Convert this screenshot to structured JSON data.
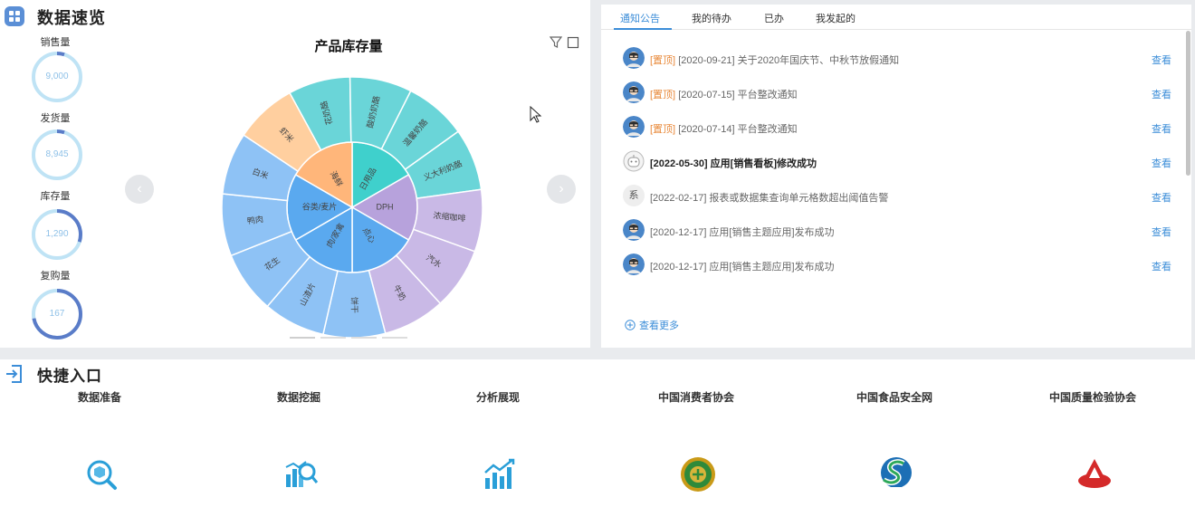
{
  "overview": {
    "title": "数据速览",
    "metrics": [
      {
        "label": "销售量",
        "value": "9,000",
        "fill": 0.05
      },
      {
        "label": "发货量",
        "value": "8,945",
        "fill": 0.05
      },
      {
        "label": "库存量",
        "value": "1,290",
        "fill": 0.3
      },
      {
        "label": "复购量",
        "value": "167",
        "fill": 0.72
      }
    ]
  },
  "chart_data": {
    "type": "sunburst",
    "title": "产品库存量",
    "inner": [
      {
        "name": "日用品",
        "color": "#3fd0cc"
      },
      {
        "name": "DPH",
        "color": "#b7a2dc"
      },
      {
        "name": "点心",
        "color": "#5aa9ef"
      },
      {
        "name": "肉/家禽",
        "color": "#5aa9ef"
      },
      {
        "name": "谷类/麦片",
        "color": "#5aa9ef"
      },
      {
        "name": "海鲜",
        "color": "#ffb67a"
      }
    ],
    "outer": [
      {
        "name": "花奶酪",
        "color": "#6ad5d8"
      },
      {
        "name": "酸奶奶酪",
        "color": "#6ad5d8"
      },
      {
        "name": "温馨奶酪",
        "color": "#6ad5d8"
      },
      {
        "name": "义大利奶酪",
        "color": "#6ad5d8"
      },
      {
        "name": "浓缩咖啡",
        "color": "#c9b9e6"
      },
      {
        "name": "汽水",
        "color": "#c9b9e6"
      },
      {
        "name": "牛奶",
        "color": "#c9b9e6"
      },
      {
        "name": "饼干",
        "color": "#8ec2f5"
      },
      {
        "name": "山渣片",
        "color": "#8ec2f5"
      },
      {
        "name": "花生",
        "color": "#8ec2f5"
      },
      {
        "name": "鸭肉",
        "color": "#8ec2f5"
      },
      {
        "name": "白米",
        "color": "#8ec2f5"
      },
      {
        "name": "虾米",
        "color": "#ffcf9f"
      }
    ]
  },
  "notices": {
    "tabs": [
      "通知公告",
      "我的待办",
      "已办",
      "我发起的"
    ],
    "active_tab": 0,
    "items": [
      {
        "pin": "[置顶]",
        "text": "[2020-09-21]  关于2020年国庆节、中秋节放假通知",
        "avatar": "person",
        "bold": false
      },
      {
        "pin": "[置顶]",
        "text": "[2020-07-15]  平台整改通知",
        "avatar": "person",
        "bold": false
      },
      {
        "pin": "[置顶]",
        "text": "[2020-07-14]  平台整改通知",
        "avatar": "person",
        "bold": false
      },
      {
        "pin": "",
        "text": "[2022-05-30]  应用[销售看板]修改成功",
        "avatar": "robot",
        "bold": true
      },
      {
        "pin": "",
        "text": "[2022-02-17]  报表或数据集查询单元格数超出阈值告警",
        "avatar": "system",
        "bold": false
      },
      {
        "pin": "",
        "text": "[2020-12-17]  应用[销售主题应用]发布成功",
        "avatar": "person",
        "bold": false
      },
      {
        "pin": "",
        "text": "[2020-12-17]  应用[销售主题应用]发布成功",
        "avatar": "person",
        "bold": false
      }
    ],
    "view_label": "查看",
    "system_avatar_text": "系",
    "more_label": "查看更多"
  },
  "shortcuts": {
    "title": "快捷入口",
    "items": [
      {
        "label": "数据准备",
        "icon": "data-prep-icon"
      },
      {
        "label": "数据挖掘",
        "icon": "data-mining-icon"
      },
      {
        "label": "分析展现",
        "icon": "analysis-icon"
      },
      {
        "label": "中国消费者协会",
        "icon": "consumer-association-logo"
      },
      {
        "label": "中国食品安全网",
        "icon": "food-safety-logo"
      },
      {
        "label": "中国质量检验协会",
        "icon": "quality-inspection-logo"
      }
    ]
  },
  "colors": {
    "accent": "#3b8dd8",
    "pin": "#e8893a",
    "gauge_ring": "#bfe3f5",
    "gauge_arc": "#5a7cc8"
  }
}
